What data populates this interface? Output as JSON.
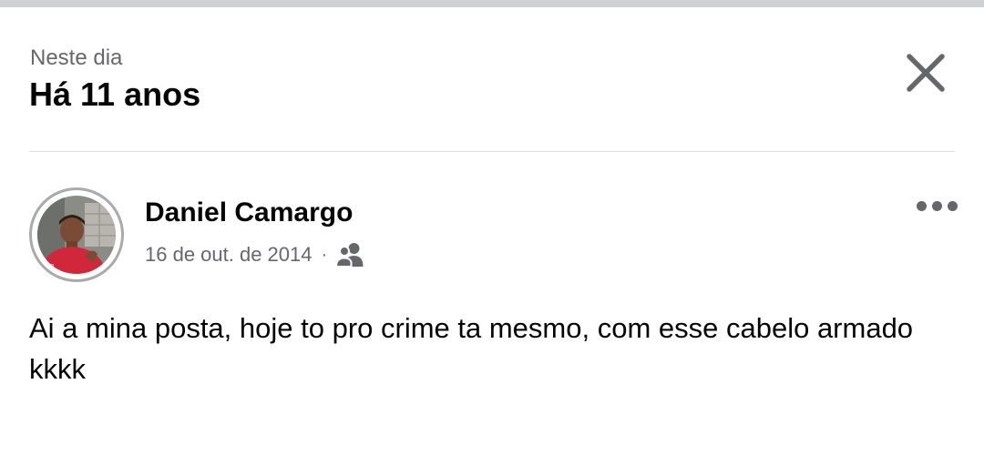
{
  "header": {
    "eyebrow": "Neste dia",
    "title": "Há 11 anos",
    "close_icon": "close-icon"
  },
  "post": {
    "author": "Daniel Camargo",
    "date": "16 de out. de 2014",
    "separator": "·",
    "audience_icon": "friends-icon",
    "more_icon": "more-options-icon",
    "text": "Ai a mina posta, hoje to pro crime ta mesmo, com esse cabelo armado kkkk"
  },
  "colors": {
    "primary_text": "#050505",
    "secondary_text": "#65676b",
    "divider": "#dadde1",
    "top_strip": "#cfd1d4"
  }
}
